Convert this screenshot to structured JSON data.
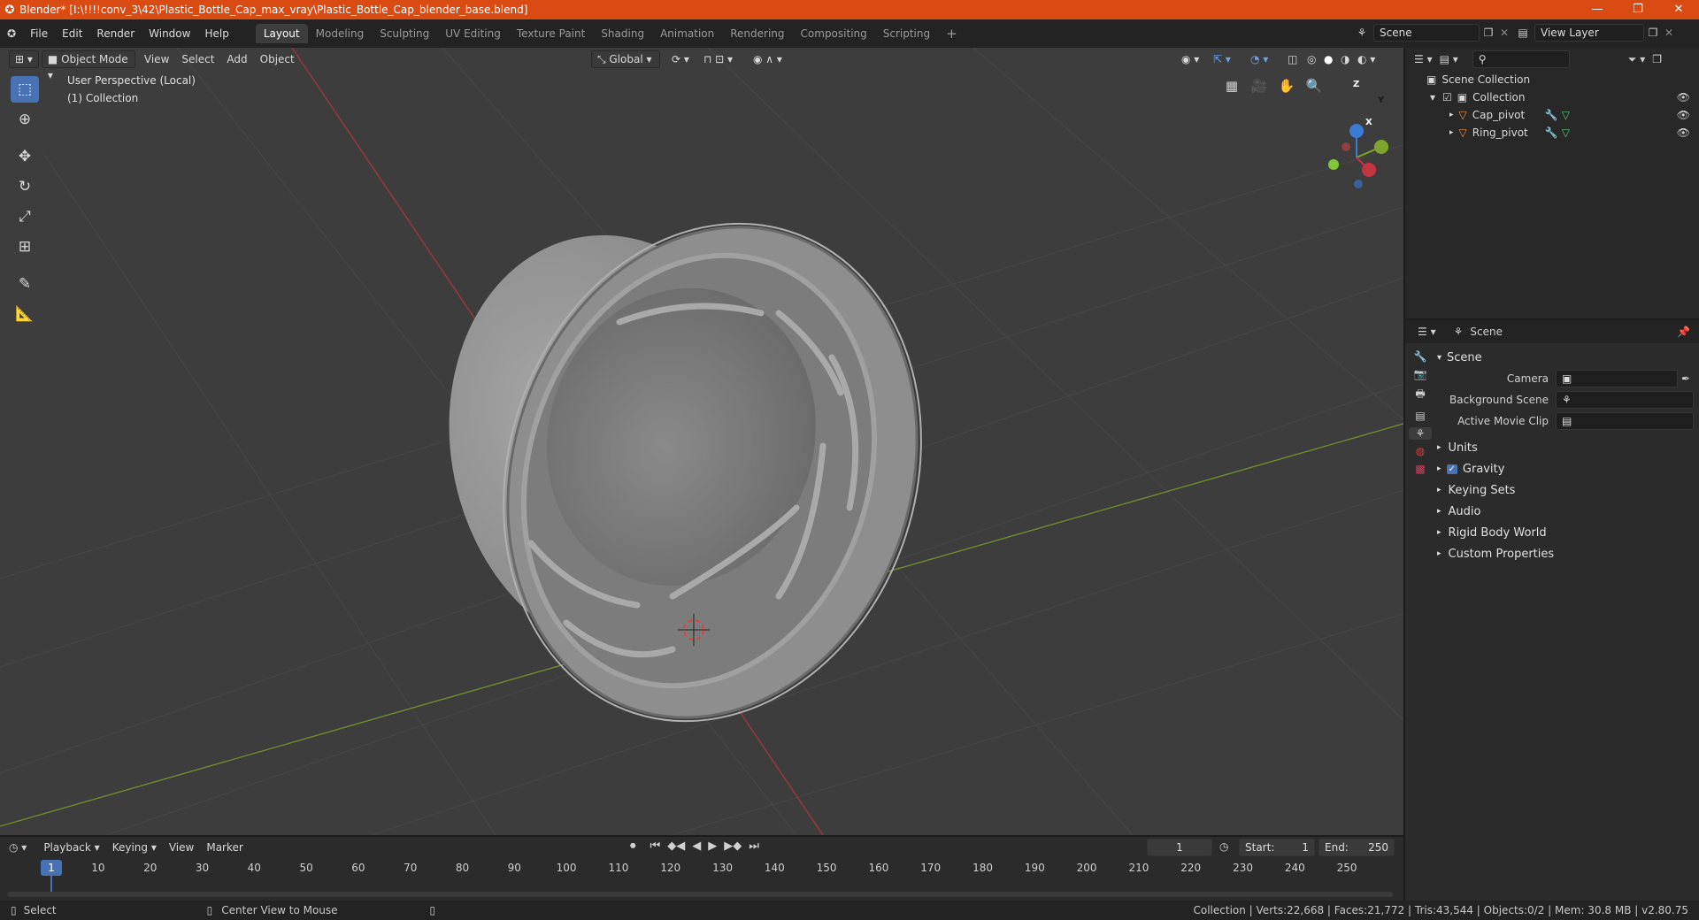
{
  "window": {
    "title": "Blender* [I:\\!!!!conv_3\\42\\Plastic_Bottle_Cap_max_vray\\Plastic_Bottle_Cap_blender_base.blend]",
    "minimize": "—",
    "maximize": "❐",
    "close": "✕"
  },
  "menu": [
    "File",
    "Edit",
    "Render",
    "Window",
    "Help"
  ],
  "workspaces": [
    "Layout",
    "Modeling",
    "Sculpting",
    "UV Editing",
    "Texture Paint",
    "Shading",
    "Animation",
    "Rendering",
    "Compositing",
    "Scripting"
  ],
  "active_workspace": "Layout",
  "add_workspace": "+",
  "scene_field": "Scene",
  "view_layer_field": "View Layer",
  "viewport": {
    "mode": "Object Mode",
    "header_menus": [
      "View",
      "Select",
      "Add",
      "Object"
    ],
    "transform_orientation": "Global",
    "perspective_label": "User Perspective (Local)",
    "collection_label": "(1) Collection",
    "gizmo": {
      "z": "Z",
      "y": "Y",
      "x": "X"
    }
  },
  "outliner": {
    "root": "Scene Collection",
    "collection": "Collection",
    "objects": [
      "Cap_pivot",
      "Ring_pivot"
    ]
  },
  "properties": {
    "context": "Scene",
    "panel": "Scene",
    "fields": [
      {
        "label": "Camera"
      },
      {
        "label": "Background Scene"
      },
      {
        "label": "Active Movie Clip"
      }
    ],
    "subpanels": [
      "Units",
      "Gravity",
      "Keying Sets",
      "Audio",
      "Rigid Body World",
      "Custom Properties"
    ],
    "gravity_checked": true
  },
  "timeline": {
    "menus": [
      "Playback",
      "Keying",
      "View",
      "Marker"
    ],
    "current_frame": "1",
    "start_label": "Start:",
    "start": "1",
    "end_label": "End:",
    "end": "250",
    "ticks": [
      "1",
      "10",
      "20",
      "30",
      "40",
      "50",
      "60",
      "70",
      "80",
      "90",
      "100",
      "110",
      "120",
      "130",
      "140",
      "150",
      "160",
      "170",
      "180",
      "190",
      "200",
      "210",
      "220",
      "230",
      "240",
      "250"
    ]
  },
  "status": {
    "left_action": "Select",
    "middle_action": "Center View to Mouse",
    "stats": "Collection | Verts:22,668 | Faces:21,772 | Tris:43,544 | Objects:0/2 | Mem: 30.8 MB | v2.80.75"
  },
  "colors": {
    "titlebar": "#d94b12",
    "accent": "#4772b3",
    "viewport_bg": "#3d3d3d",
    "x_axis": "#c4343f",
    "y_axis": "#7fa62c",
    "z_axis": "#3a7bd5"
  }
}
